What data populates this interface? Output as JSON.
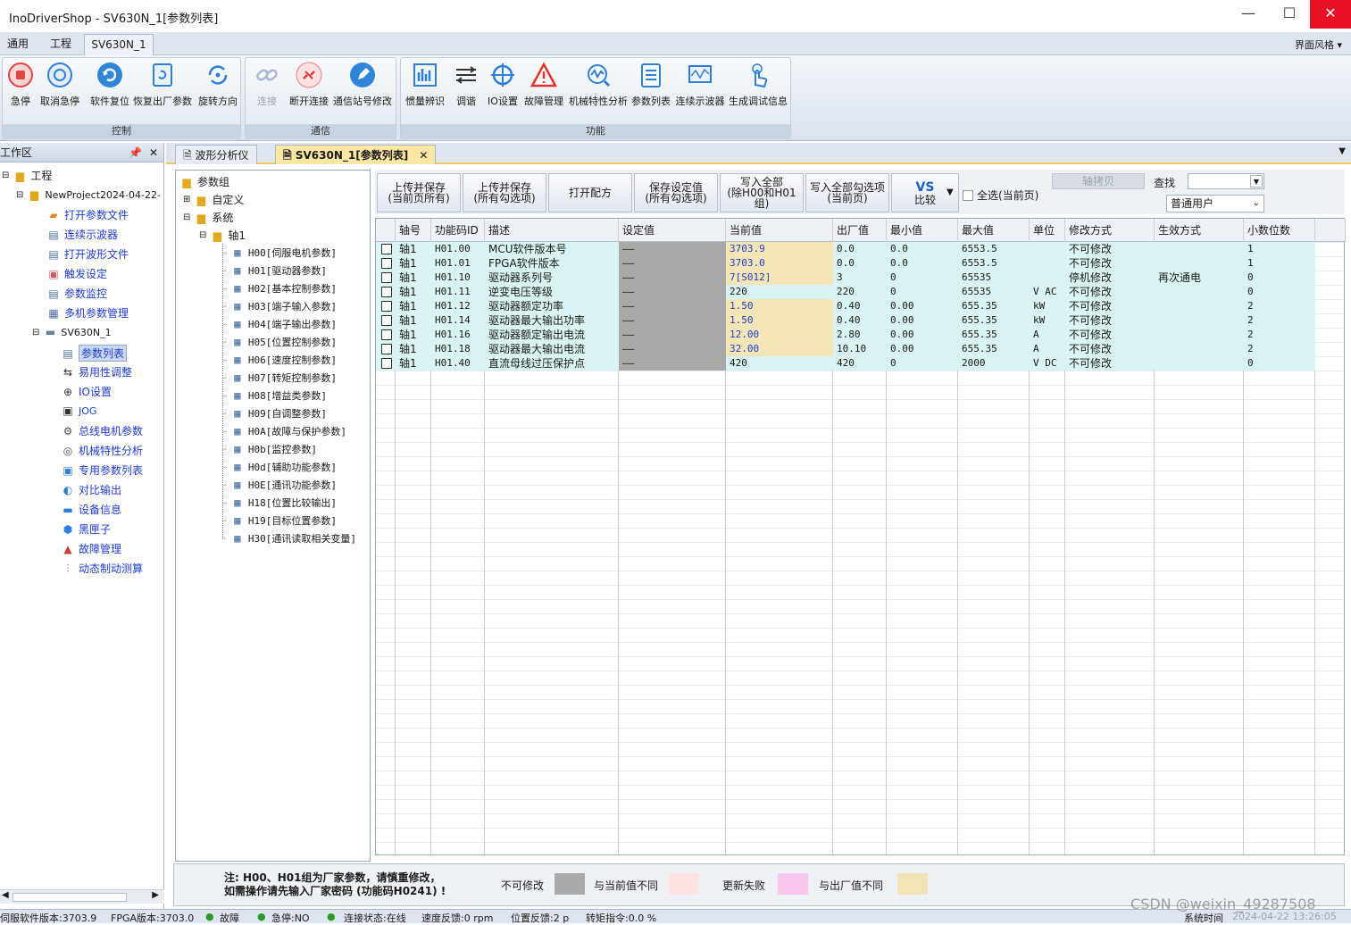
{
  "window": {
    "title": "InoDriverShop - SV630N_1[参数列表]",
    "minimize": "—",
    "maximize": "☐",
    "close": "✕"
  },
  "menu_tabs": [
    "通用",
    "工程",
    "SV630N_1"
  ],
  "style_menu": "界面风格",
  "ribbon": {
    "groups": [
      {
        "label": "控制",
        "buttons": [
          "急停",
          "取消急停",
          "软件复位",
          "恢复出厂参数",
          "旋转方向"
        ]
      },
      {
        "label": "通信",
        "buttons": [
          "连接",
          "断开连接",
          "通信站号修改"
        ]
      },
      {
        "label": "功能",
        "buttons": [
          "惯量辨识",
          "调谐",
          "IO设置",
          "故障管理",
          "机械特性分析",
          "参数列表",
          "连续示波器",
          "生成调试信息"
        ]
      }
    ]
  },
  "work_panel": {
    "title": "工作区",
    "pin": "📌",
    "close": "✕",
    "tree": {
      "root": "工程",
      "project": "NewProject2024-04-22-",
      "project_items": [
        "打开参数文件",
        "连续示波器",
        "打开波形文件",
        "触发设定",
        "参数监控",
        "多机参数管理"
      ],
      "device": "SV630N_1",
      "device_items": [
        "参数列表",
        "易用性调整",
        "IO设置",
        "JOG",
        "总线电机参数",
        "机械特性分析",
        "专用参数列表",
        "对比输出",
        "设备信息",
        "黑匣子",
        "故障管理",
        "动态制动测算"
      ]
    }
  },
  "doc_tabs": [
    "波形分析仪",
    "SV630N_1[参数列表]"
  ],
  "param_tree": {
    "root": "参数组",
    "custom": "自定义",
    "system": "系统",
    "axis": "轴1",
    "groups": [
      "H00[伺服电机参数]",
      "H01[驱动器参数]",
      "H02[基本控制参数]",
      "H03[端子输入参数]",
      "H04[端子输出参数]",
      "H05[位置控制参数]",
      "H06[速度控制参数]",
      "H07[转矩控制参数]",
      "H08[增益类参数]",
      "H09[自调整参数]",
      "H0A[故障与保护参数]",
      "H0b[监控参数]",
      "H0d[辅助功能参数]",
      "H0E[通讯功能参数]",
      "H18[位置比较输出]",
      "H19[目标位置参数]",
      "H30[通讯读取相关变量]"
    ]
  },
  "toolbar": {
    "upload_current": [
      "上传并保存",
      "(当前页所有)"
    ],
    "upload_checked": [
      "上传并保存",
      "(所有勾选项)"
    ],
    "open_recipe": "打开配方",
    "save_setting": [
      "保存设定值",
      "(所有勾选项)"
    ],
    "write_all": [
      "写入全部",
      "(除H00和H01组)"
    ],
    "write_checked": [
      "写入全部勾选项",
      "(当前页)"
    ],
    "compare_vs": "VS",
    "compare": "比较",
    "select_all": "全选(当前页)",
    "axis_copy": "轴拷贝",
    "search_label": "查找",
    "search_value": "",
    "user_level": "普通用户"
  },
  "table": {
    "columns": [
      "轴号",
      "功能码ID",
      "描述",
      "设定值",
      "当前值",
      "出厂值",
      "最小值",
      "最大值",
      "单位",
      "修改方式",
      "生效方式",
      "小数位数"
    ],
    "rows": [
      {
        "axis": "轴1",
        "id": "H01.00",
        "desc": "MCU软件版本号",
        "set": "——",
        "cur": "3703.9",
        "factory": "0.0",
        "min": "0.0",
        "max": "6553.5",
        "unit": "",
        "mod": "不可修改",
        "eff": "",
        "dec": "1",
        "cur_bg": "#f5e6b8",
        "cur_color": "#1f3ccf"
      },
      {
        "axis": "轴1",
        "id": "H01.01",
        "desc": "FPGA软件版本",
        "set": "——",
        "cur": "3703.0",
        "factory": "0.0",
        "min": "0.0",
        "max": "6553.5",
        "unit": "",
        "mod": "不可修改",
        "eff": "",
        "dec": "1",
        "cur_bg": "#f5e6b8",
        "cur_color": "#1f3ccf"
      },
      {
        "axis": "轴1",
        "id": "H01.10",
        "desc": "驱动器系列号",
        "set": "——",
        "cur": "7[S012]",
        "factory": "3",
        "min": "0",
        "max": "65535",
        "unit": "",
        "mod": "停机修改",
        "eff": "再次通电",
        "dec": "0",
        "cur_bg": "#f5e6b8",
        "cur_color": "#1f3ccf"
      },
      {
        "axis": "轴1",
        "id": "H01.11",
        "desc": "逆变电压等级",
        "set": "——",
        "cur": "220",
        "factory": "220",
        "min": "0",
        "max": "65535",
        "unit": "V AC",
        "mod": "不可修改",
        "eff": "",
        "dec": "0",
        "cur_bg": "",
        "cur_color": "#1a1a1a"
      },
      {
        "axis": "轴1",
        "id": "H01.12",
        "desc": "驱动器额定功率",
        "set": "——",
        "cur": "1.50",
        "factory": "0.40",
        "min": "0.00",
        "max": "655.35",
        "unit": "kW",
        "mod": "不可修改",
        "eff": "",
        "dec": "2",
        "cur_bg": "#f5e6b8",
        "cur_color": "#1f3ccf"
      },
      {
        "axis": "轴1",
        "id": "H01.14",
        "desc": "驱动器最大输出功率",
        "set": "——",
        "cur": "1.50",
        "factory": "0.40",
        "min": "0.00",
        "max": "655.35",
        "unit": "kW",
        "mod": "不可修改",
        "eff": "",
        "dec": "2",
        "cur_bg": "#f5e6b8",
        "cur_color": "#1f3ccf"
      },
      {
        "axis": "轴1",
        "id": "H01.16",
        "desc": "驱动器额定输出电流",
        "set": "——",
        "cur": "12.00",
        "factory": "2.80",
        "min": "0.00",
        "max": "655.35",
        "unit": "A",
        "mod": "不可修改",
        "eff": "",
        "dec": "2",
        "cur_bg": "#f5e6b8",
        "cur_color": "#1f3ccf"
      },
      {
        "axis": "轴1",
        "id": "H01.18",
        "desc": "驱动器最大输出电流",
        "set": "——",
        "cur": "32.00",
        "factory": "10.10",
        "min": "0.00",
        "max": "655.35",
        "unit": "A",
        "mod": "不可修改",
        "eff": "",
        "dec": "2",
        "cur_bg": "#f5e6b8",
        "cur_color": "#1f3ccf"
      },
      {
        "axis": "轴1",
        "id": "H01.40",
        "desc": "直流母线过压保护点",
        "set": "——",
        "cur": "420",
        "factory": "420",
        "min": "0",
        "max": "2000",
        "unit": "V DC",
        "mod": "不可修改",
        "eff": "",
        "dec": "0",
        "cur_bg": "",
        "cur_color": "#1a1a1a"
      }
    ]
  },
  "legend": {
    "note_line1": "注: H00、H01组为厂家参数，请慎重修改，",
    "note_line2": "如需操作请先输入厂家密码 (功能码H0241) !",
    "items": [
      {
        "label": "不可修改",
        "color": "#a9a9a9"
      },
      {
        "label": "与当前值不同",
        "color": "#fde3e1"
      },
      {
        "label": "更新失败",
        "color": "#fac6f0"
      },
      {
        "label": "与出厂值不同",
        "color": "#f2e3b9"
      }
    ]
  },
  "status_bar": {
    "servo_version": "伺服软件版本:3703.9",
    "fpga_version": "FPGA版本:3703.0",
    "fault": "故障",
    "estop": "急停:NO",
    "connection": "连接状态:在线",
    "speed": "速度反馈:0 rpm",
    "position": "位置反馈:2 p",
    "torque": "转矩指令:0.0 %",
    "sys_time_label": "系统时间",
    "sys_time": "2024-04-22 13:26:05"
  },
  "watermark": "CSDN @weixin_49287508",
  "colors": {
    "grey_cell": "#a9a9a9",
    "row_cyan": "#d9f4f2",
    "accent_tab": "#f0c95a"
  }
}
